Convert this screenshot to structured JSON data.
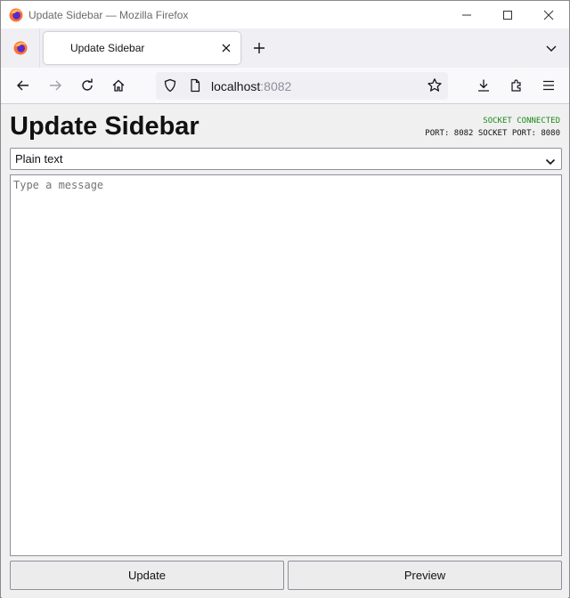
{
  "window": {
    "title": "Update Sidebar — Mozilla Firefox"
  },
  "tabs": [
    {
      "label": "Update Sidebar"
    }
  ],
  "urlbar": {
    "host": "localhost",
    "port": ":8082"
  },
  "page": {
    "title": "Update Sidebar",
    "status": {
      "connection": "SOCKET CONNECTED",
      "ports": "PORT: 8082 SOCKET PORT: 8080"
    },
    "format_select": {
      "selected": "Plain text"
    },
    "message": {
      "placeholder": "Type a message",
      "value": ""
    },
    "buttons": {
      "update": "Update",
      "preview": "Preview"
    }
  },
  "colors": {
    "status_connected": "#1d8a1d",
    "page_background": "#f0f0f0"
  },
  "icons": [
    "firefox-logo",
    "minimize-icon",
    "maximize-icon",
    "close-icon",
    "tab-close-icon",
    "plus-icon",
    "chevron-down-icon",
    "back-arrow-icon",
    "forward-arrow-icon",
    "reload-icon",
    "home-icon",
    "shield-icon",
    "page-icon",
    "star-icon",
    "download-icon",
    "extensions-icon",
    "menu-icon"
  ]
}
